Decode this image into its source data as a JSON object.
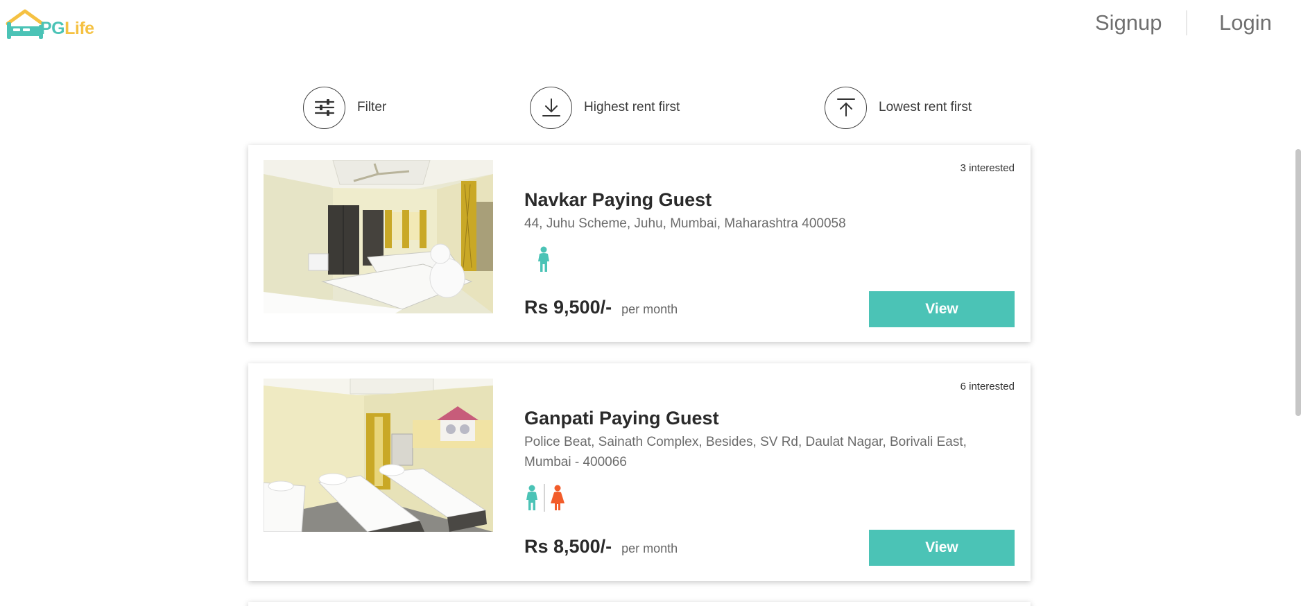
{
  "header": {
    "logo": {
      "pg": "PG",
      "life": "Life",
      "icon": "house-bed-icon"
    },
    "nav": {
      "signup": "Signup",
      "login": "Login"
    }
  },
  "sort_bar": {
    "filter": {
      "label": "Filter",
      "icon": "sliders-icon"
    },
    "highest": {
      "label": "Highest rent first",
      "icon": "arrow-down-to-line-icon"
    },
    "lowest": {
      "label": "Lowest rent first",
      "icon": "arrow-up-from-line-icon"
    }
  },
  "listings": [
    {
      "interested": "3 interested",
      "name": "Navkar Paying Guest",
      "address": "44, Juhu Scheme, Juhu, Mumbai, Maharashtra 400058",
      "gender_icons": [
        "male-icon"
      ],
      "rent": "Rs 9,500/-",
      "per": "per month",
      "view_label": "View"
    },
    {
      "interested": "6 interested",
      "name": "Ganpati Paying Guest",
      "address": "Police Beat, Sainath Complex, Besides, SV Rd, Daulat Nagar, Borivali East, Mumbai - 400066",
      "gender_icons": [
        "male-icon",
        "female-icon"
      ],
      "rent": "Rs 8,500/-",
      "per": "per month",
      "view_label": "View"
    }
  ],
  "colors": {
    "accent": "#4bc3b6",
    "logo_yellow": "#f5c142",
    "female": "#f25c2a"
  }
}
